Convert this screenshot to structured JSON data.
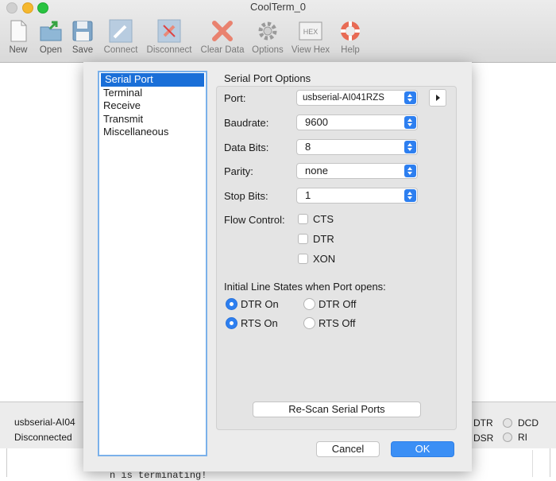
{
  "window": {
    "title": "CoolTerm_0"
  },
  "toolbar": {
    "new": "New",
    "open": "Open",
    "save": "Save",
    "connect": "Connect",
    "disconnect": "Disconnect",
    "clear_data": "Clear Data",
    "options": "Options",
    "view_hex": "View Hex",
    "hex_badge": "HEX",
    "help": "Help"
  },
  "sidebar": {
    "items": [
      "Serial Port",
      "Terminal",
      "Receive",
      "Transmit",
      "Miscellaneous"
    ],
    "selected": "Serial Port"
  },
  "serial": {
    "section_title": "Serial Port Options",
    "port_label": "Port:",
    "port_value": "usbserial-AI041RZS",
    "baud_label": "Baudrate:",
    "baud_value": "9600",
    "databits_label": "Data Bits:",
    "databits_value": "8",
    "parity_label": "Parity:",
    "parity_value": "none",
    "stopbits_label": "Stop Bits:",
    "stopbits_value": "1",
    "flow_label": "Flow Control:",
    "flow_options": [
      "CTS",
      "DTR",
      "XON"
    ],
    "initial_title": "Initial Line States when Port opens:",
    "dtr_on": "DTR On",
    "dtr_off": "DTR Off",
    "rts_on": "RTS On",
    "rts_off": "RTS Off",
    "rescan": "Re-Scan Serial Ports"
  },
  "dialog_buttons": {
    "cancel": "Cancel",
    "ok": "OK"
  },
  "status": {
    "port": "usbserial-AI04",
    "state": "Disconnected",
    "dtr": "DTR",
    "dcd": "DCD",
    "dsr": "DSR",
    "ri": "RI"
  },
  "terminal_text": "n is terminating!",
  "colors": {
    "accent": "#2d7ff0",
    "selection": "#1a6fd8"
  }
}
